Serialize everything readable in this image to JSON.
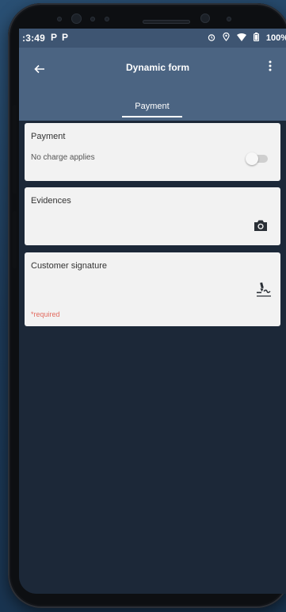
{
  "status_bar": {
    "time": ":3:49",
    "notif_p1": "P",
    "notif_p2": "P",
    "battery": "100%"
  },
  "app_bar": {
    "title": "Dynamic form",
    "back_icon": "arrow-left-icon",
    "menu_icon": "more-vert-icon"
  },
  "tabs": [
    {
      "label": "Payment",
      "selected": true
    }
  ],
  "form": {
    "payment": {
      "title": "Payment",
      "subtitle": "No charge applies",
      "toggle_on": false
    },
    "evidences": {
      "title": "Evidences",
      "icon": "camera-icon"
    },
    "signature": {
      "title": "Customer signature",
      "required": "*required",
      "icon": "signature-icon"
    }
  },
  "colors": {
    "app_bar": "#4b6482",
    "status_bar": "#3e5572",
    "background": "#1c2838",
    "card": "#f2f2f2",
    "required": "#e26b5f"
  }
}
